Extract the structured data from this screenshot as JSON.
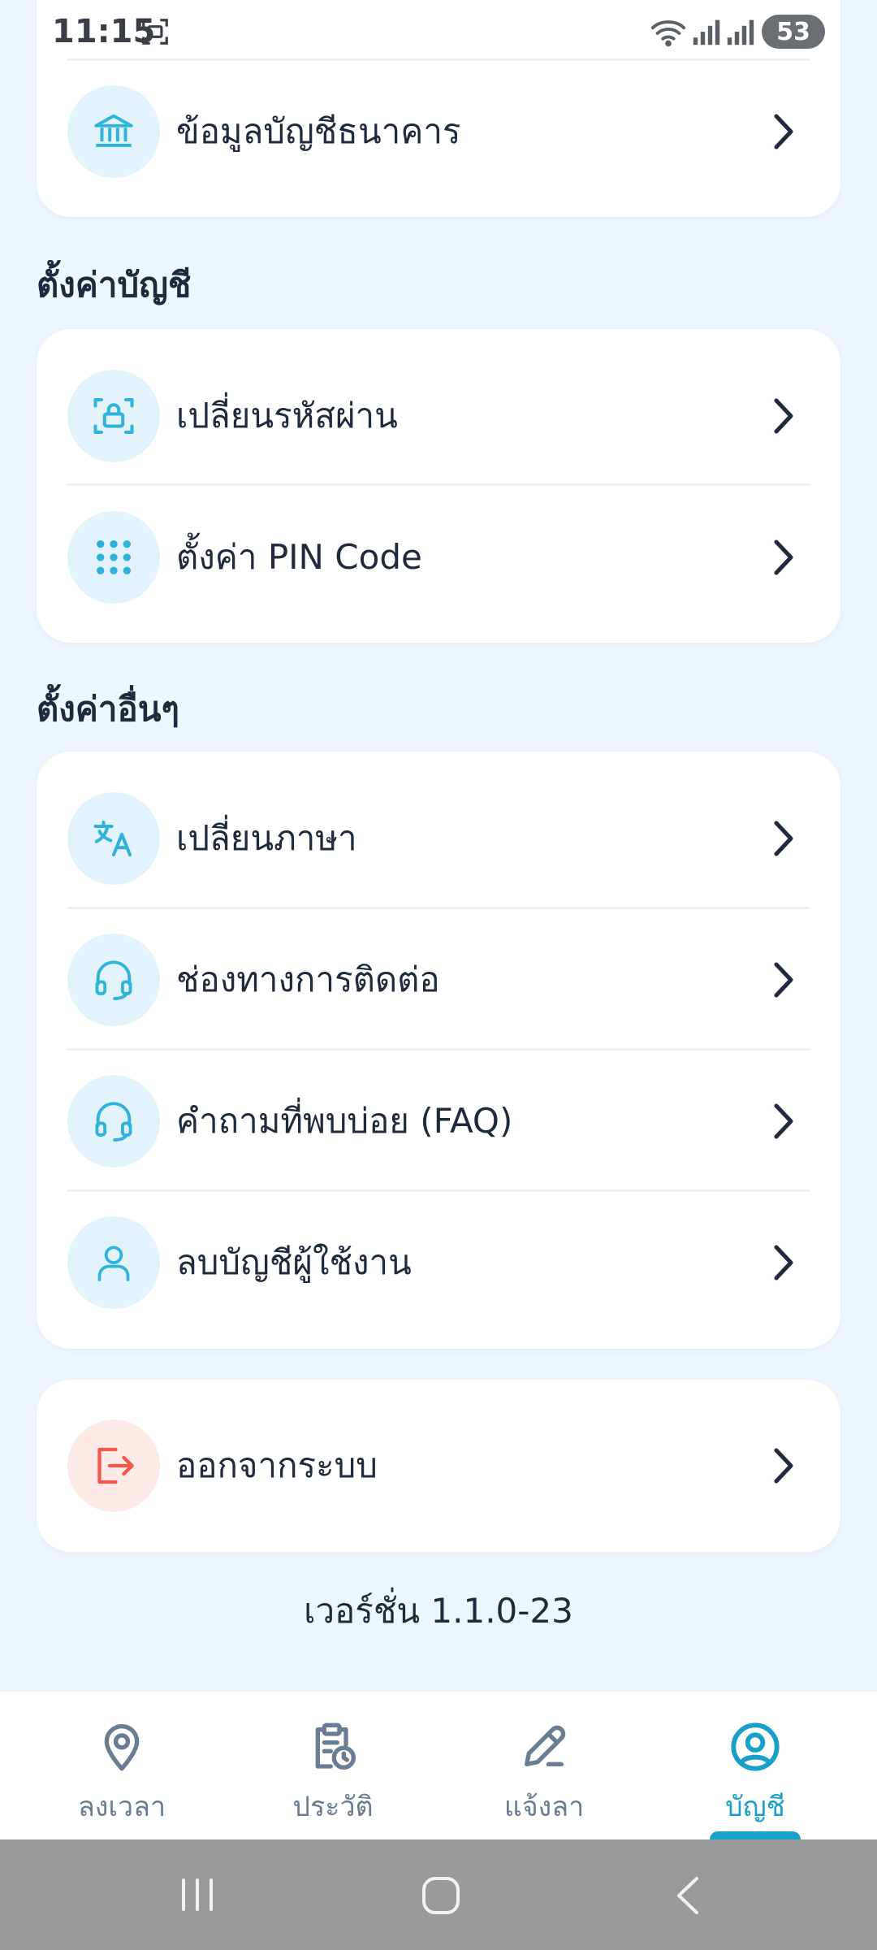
{
  "status_bar": {
    "time": "11:15",
    "battery": "53"
  },
  "top_card": {
    "bank_info_label": "ข้อมูลบัญชีธนาคาร"
  },
  "sections": {
    "account_settings": {
      "title": "ตั้งค่าบัญชี",
      "change_password": "เปลี่ยนรหัสผ่าน",
      "pin_code": "ตั้งค่า PIN Code"
    },
    "other_settings": {
      "title": "ตั้งค่าอื่นๆ",
      "change_language": "เปลี่ยนภาษา",
      "contact_channels": "ช่องทางการติดต่อ",
      "faq": "คำถามที่พบบ่อย (FAQ)",
      "delete_account": "ลบบัญชีผู้ใช้งาน"
    }
  },
  "logout_label": "ออกจากระบบ",
  "version": "เวอร์ชั่น 1.1.0-23",
  "bottom_nav": {
    "items": [
      {
        "label": "ลงเวลา",
        "icon": "location-pin-icon",
        "active": false
      },
      {
        "label": "ประวัติ",
        "icon": "clipboard-clock-icon",
        "active": false
      },
      {
        "label": "แจ้งลา",
        "icon": "pencil-edit-icon",
        "active": false
      },
      {
        "label": "บัญชี",
        "icon": "user-circle-icon",
        "active": true
      }
    ]
  },
  "colors": {
    "accent": "#1aa0c8",
    "icon_tint": "#2fb3dc",
    "logout_red": "#ef5a4a",
    "background": "#eef5fd"
  }
}
